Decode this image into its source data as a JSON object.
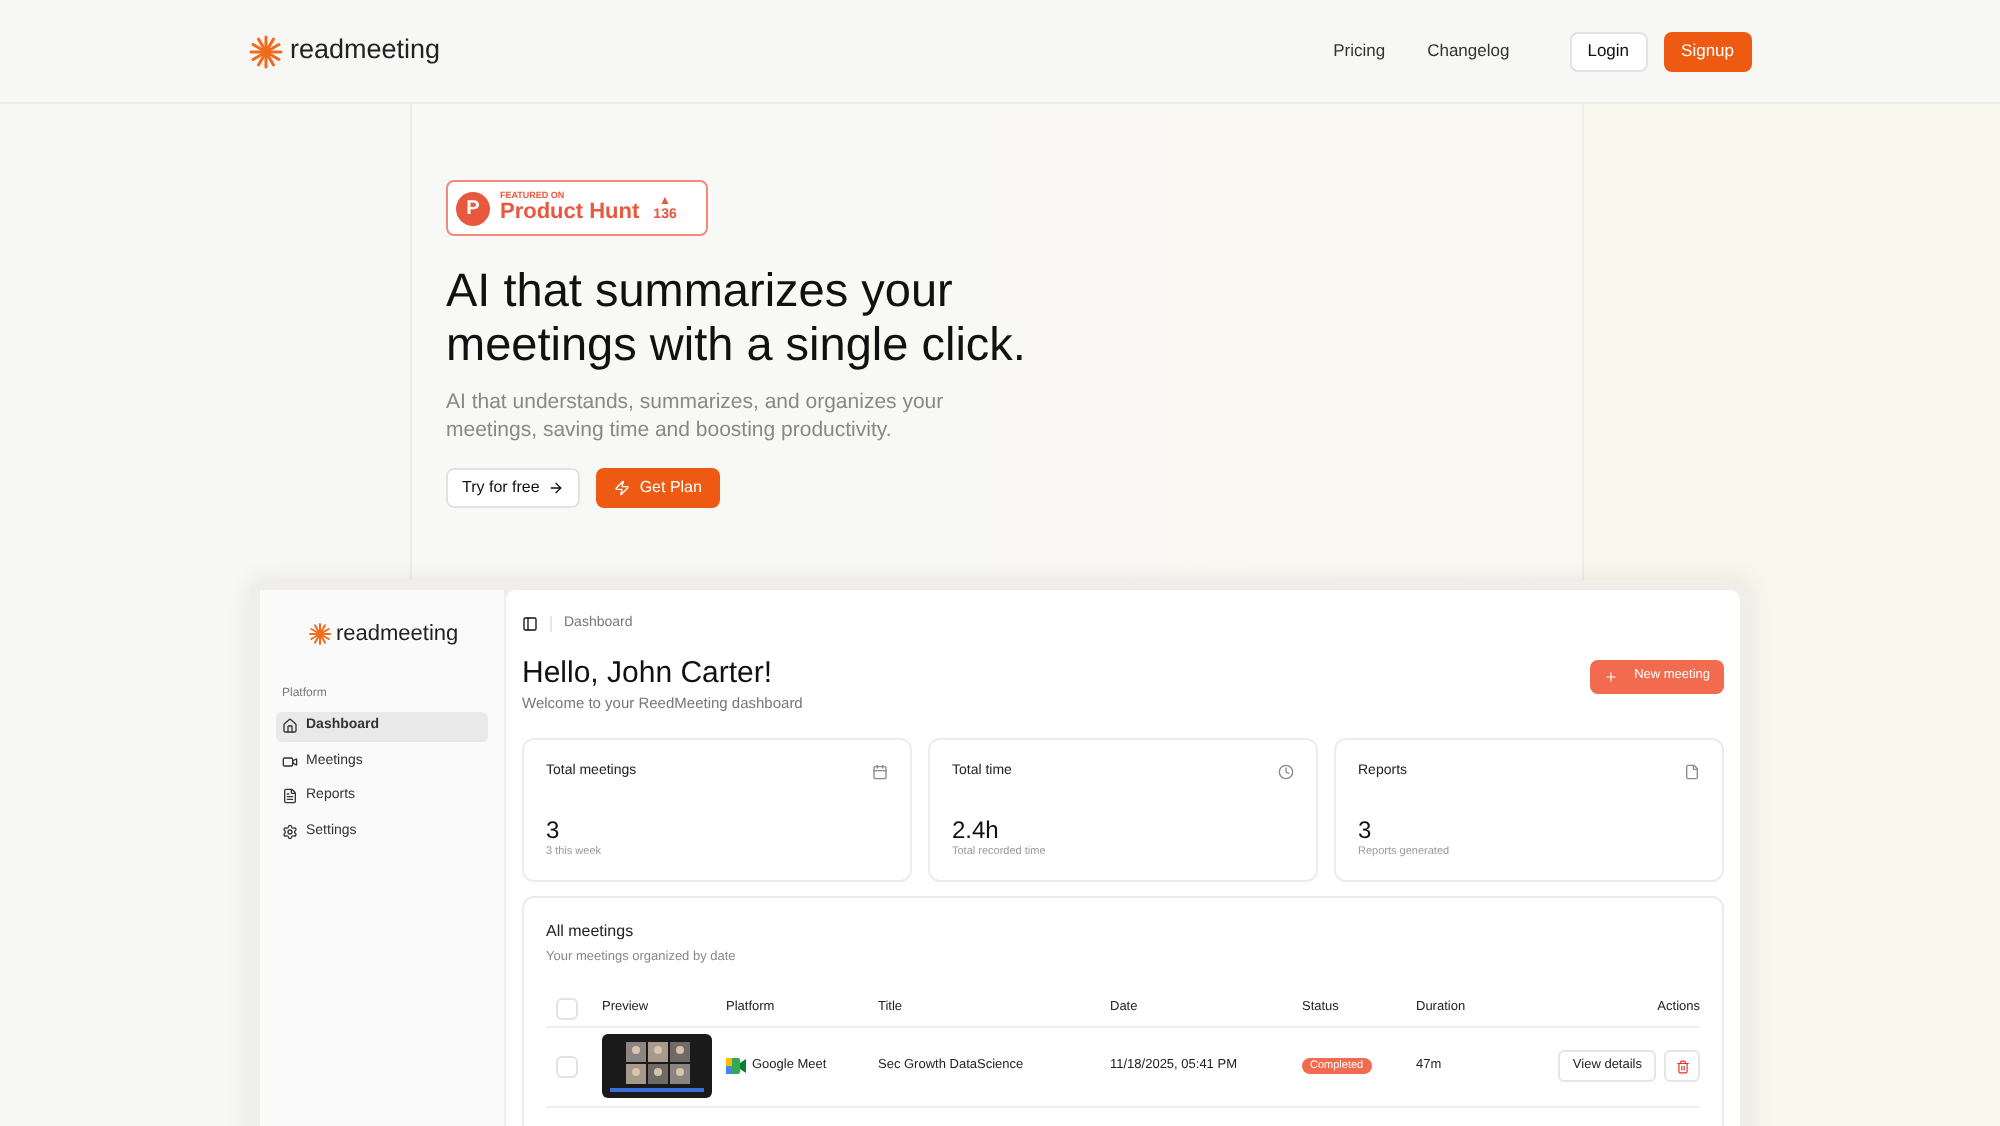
{
  "header": {
    "brand": "readmeeting",
    "nav": [
      "Pricing",
      "Changelog"
    ],
    "login": "Login",
    "signup": "Signup"
  },
  "hero": {
    "badge": {
      "logo": "P",
      "arrow": "▲",
      "small": "FEATURED ON",
      "name": "Product Hunt",
      "count": "136"
    },
    "title": "AI that summarizes your meetings with a single click.",
    "subtitle": "AI that understands, summarizes, and organizes your meetings, saving time and boosting productivity.",
    "try_button": "Try for free",
    "plan_button": "Get Plan"
  },
  "app": {
    "brand": "readmeeting",
    "section": "Platform",
    "sidebar": [
      {
        "label": "Dashboard",
        "kind": "home",
        "selected": true
      },
      {
        "label": "Meetings",
        "kind": "video",
        "selected": false
      },
      {
        "label": "Reports",
        "kind": "report",
        "selected": false
      },
      {
        "label": "Settings",
        "kind": "settings",
        "selected": false
      }
    ],
    "breadcrumb": "Dashboard",
    "greeting": "Hello, John Carter!",
    "welcome": "Welcome to your ReedMeeting dashboard",
    "new_button": "New meeting",
    "stats": [
      {
        "title": "Total meetings",
        "kind": "calendar",
        "value": "3",
        "note": "3 this week"
      },
      {
        "title": "Total time",
        "kind": "clock",
        "value": "2.4h",
        "note": "Total recorded time"
      },
      {
        "title": "Reports",
        "kind": "file",
        "value": "3",
        "note": "Reports generated"
      }
    ],
    "table": {
      "title": "All meetings",
      "subtitle": "Your meetings organized by date",
      "header_checked": false,
      "columns": [
        "Preview",
        "Platform",
        "Title",
        "Date",
        "Status",
        "Duration",
        "Actions"
      ],
      "rows": [
        {
          "checked": false,
          "platform": "Google Meet",
          "title": "Sec Growth DataScience",
          "date": "11/18/2025, 05:41 PM",
          "status": "Completed",
          "duration": "47m",
          "action": "View details"
        }
      ]
    }
  }
}
